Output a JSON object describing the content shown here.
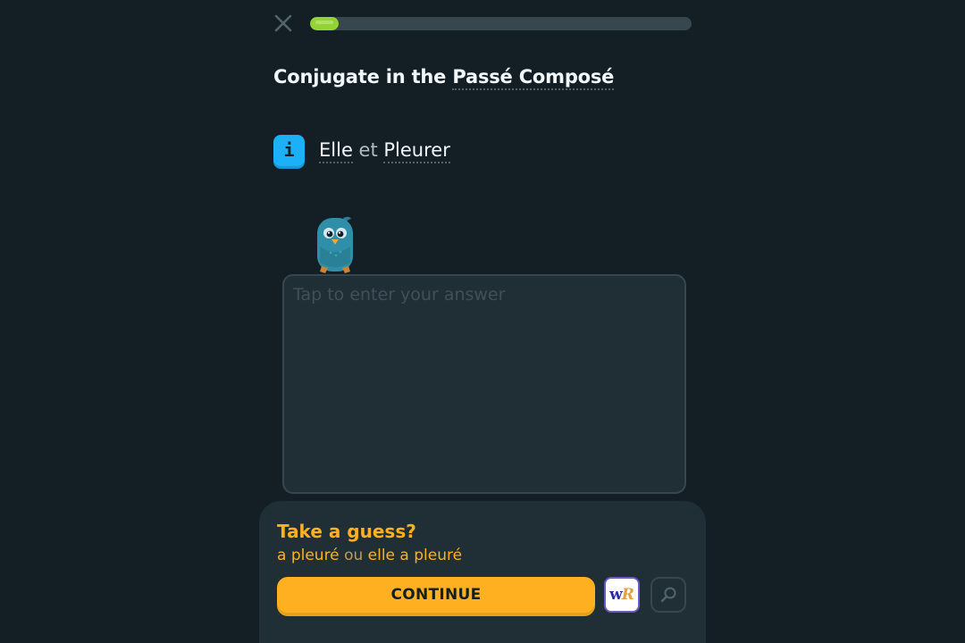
{
  "progress": {
    "value": 0.075
  },
  "exercise": {
    "title_prefix": "Conjugate in the ",
    "title_term": "Passé Composé",
    "prompt_subject": "Elle",
    "prompt_connector": "et",
    "prompt_verb": "Pleurer",
    "info_icon_text": "i"
  },
  "answer": {
    "placeholder": "Tap to enter your answer",
    "value": ""
  },
  "footer": {
    "guess_title": "Take a guess?",
    "answer_1": "a pleuré",
    "answer_or": "ou",
    "answer_2": "elle a pleuré",
    "continue_label": "CONTINUE",
    "wr_w": "w",
    "wr_r": "R"
  },
  "icons": {
    "close": "close-icon",
    "info": "info-icon",
    "mascot": "bird-mascot-icon",
    "wordreference": "wordreference-icon",
    "search": "magnifier-icon"
  },
  "colors": {
    "background": "#131f24",
    "progress_fill": "#93d333",
    "accent": "#ffb020",
    "info_blue": "#1cb0f6",
    "panel": "#202f36"
  }
}
